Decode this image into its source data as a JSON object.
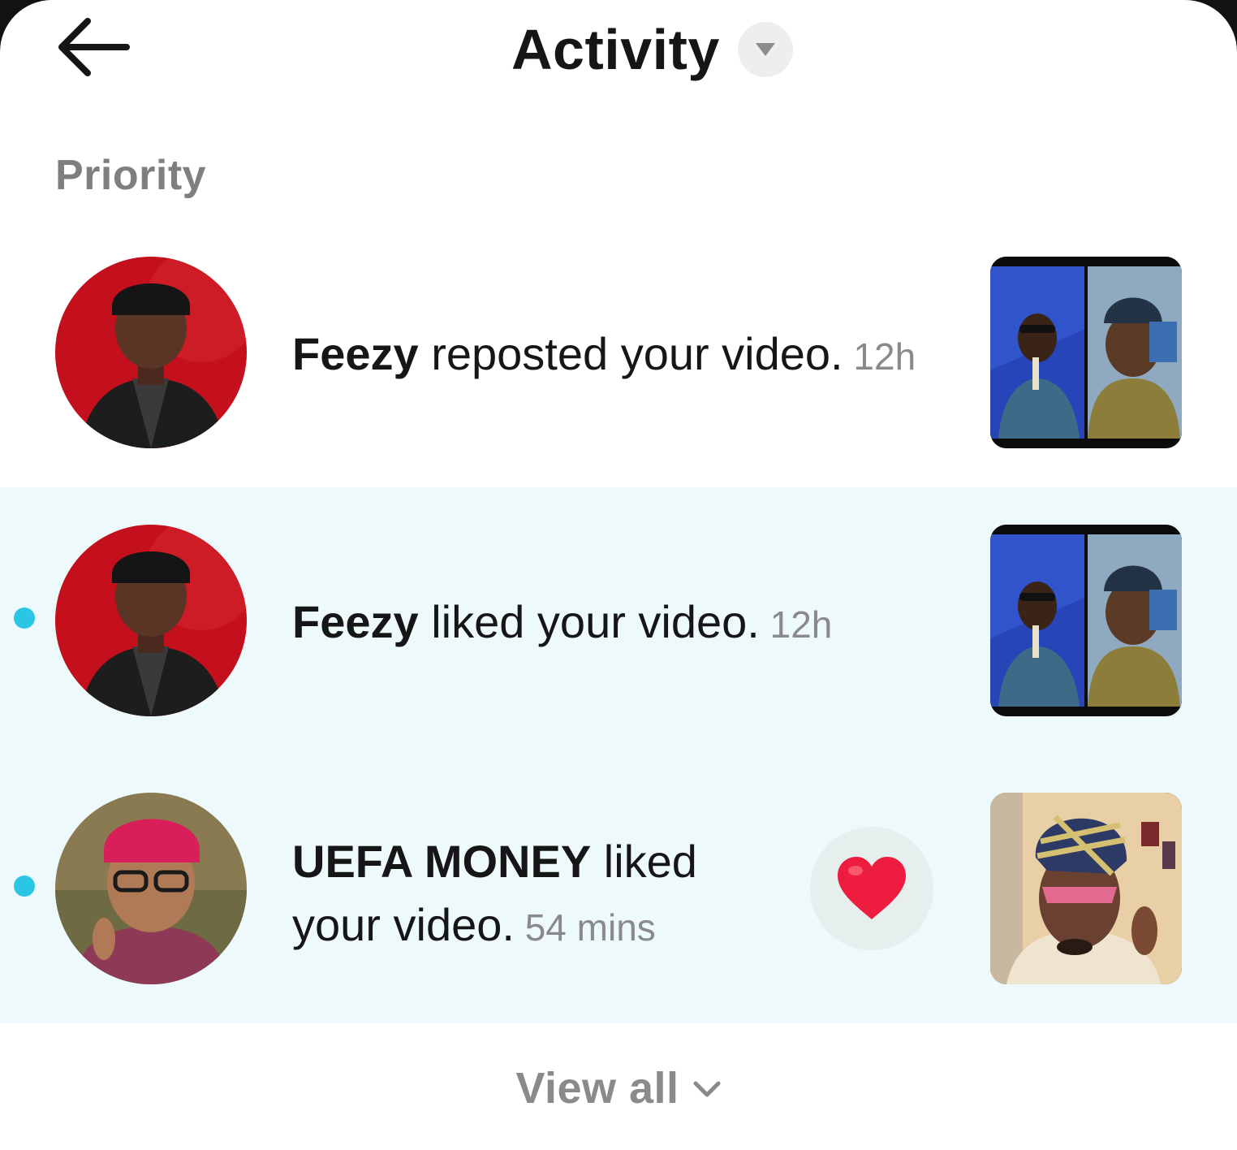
{
  "header": {
    "title": "Activity",
    "back_icon": "arrow-left-icon",
    "filter_icon": "caret-down-icon"
  },
  "section": {
    "label": "Priority"
  },
  "notifications": [
    {
      "name": "Feezy",
      "action": " reposted your video.",
      "time": " 12h",
      "unread": false
    },
    {
      "name": "Feezy",
      "action": " liked your video.",
      "time": " 12h",
      "unread": true
    },
    {
      "name": "UEFA MONEY",
      "action": " liked your video.",
      "time": " 54 mins",
      "unread": true,
      "reaction_icon": "heart-icon"
    }
  ],
  "footer": {
    "view_all_label": "View all",
    "view_all_icon": "chevron-down-icon"
  },
  "colors": {
    "unread_bg": "#edf9fb",
    "unread_dot": "#2bc6e3",
    "heart": "#ee1d3f",
    "text_primary": "#161616",
    "text_secondary": "#8a8a8a"
  }
}
